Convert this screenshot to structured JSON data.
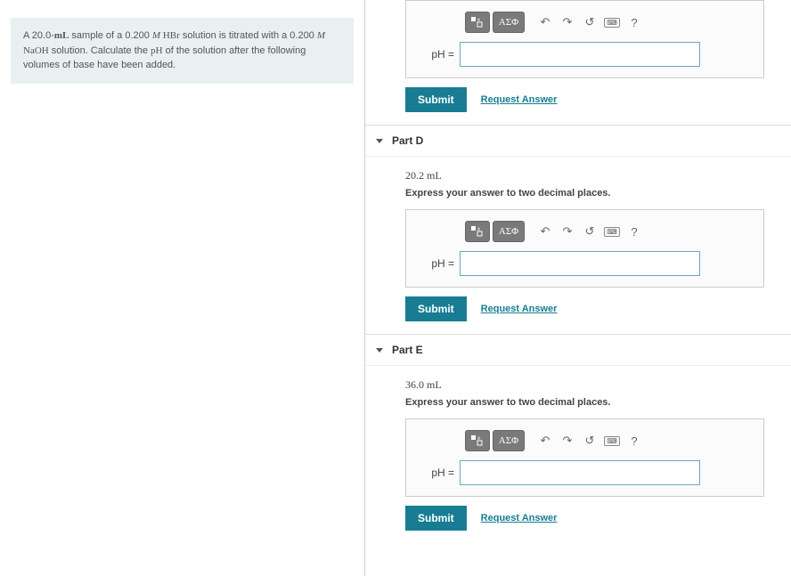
{
  "problem": {
    "p1a": "A 20.0-",
    "p1b": "mL",
    "p1c": " sample of a 0.200 ",
    "p1d": "M",
    "p1e": " HBr",
    "p1f": " solution is titrated with a 0.200 ",
    "p2a": "M",
    "p2b": " NaOH",
    "p2c": " solution. Calculate the ",
    "p2d": "pH",
    "p2e": " of the solution after the following volumes of base have been added."
  },
  "toolbar": {
    "greek": "ΑΣΦ",
    "help": "?"
  },
  "labels": {
    "ph": "pH =",
    "submit": "Submit",
    "request": "Request Answer"
  },
  "partC": {
    "answer": ""
  },
  "partD": {
    "title": "Part D",
    "volume": "20.2 mL",
    "instruction": "Express your answer to two decimal places.",
    "answer": ""
  },
  "partE": {
    "title": "Part E",
    "volume": "36.0 mL",
    "instruction": "Express your answer to two decimal places.",
    "answer": ""
  }
}
